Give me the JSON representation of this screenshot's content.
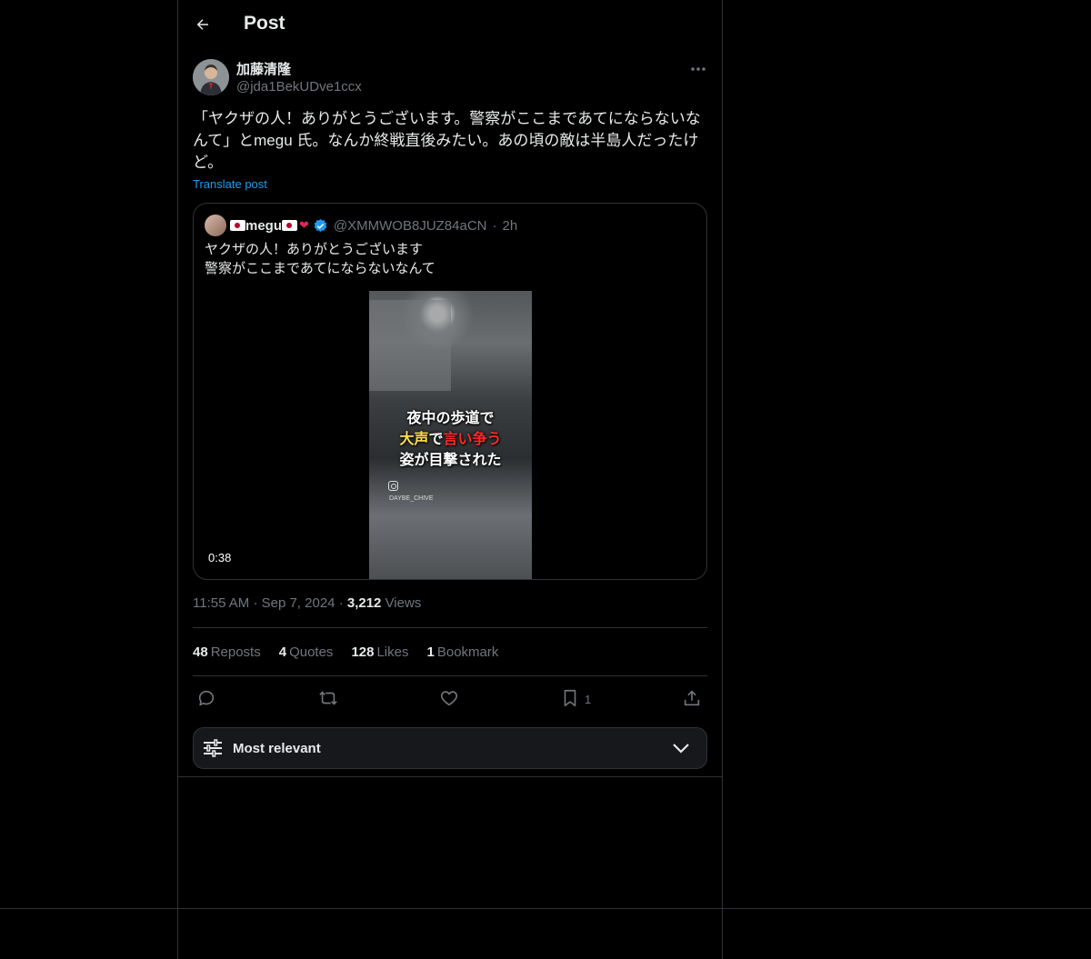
{
  "header": {
    "title": "Post"
  },
  "post": {
    "author_name": "加藤清隆",
    "author_handle": "@jda1BekUDve1ccx",
    "text": "「ヤクザの人！ありがとうございます。警察がここまであてにならないな\nんて」とmegu 氏。なんか終戦直後みたい。あの頃の敵は半島人だったけ\nど。",
    "translate_label": "Translate post"
  },
  "quote": {
    "name": "megu",
    "handle": "@XMMWOB8JUZ84aCN",
    "separator": "·",
    "time": "2h",
    "text": "ヤクザの人！ありがとうございます\n警察がここまであてにならないなんて",
    "video": {
      "caption_line1": "夜中の歩道で",
      "caption_line2_a": "大声",
      "caption_line2_b": "で",
      "caption_line2_c": "言い争う",
      "caption_line3": "姿が目撃された",
      "watermark": "DAYBE_CHIVE",
      "duration": "0:38"
    }
  },
  "meta": {
    "time": "11:55 AM",
    "date": "Sep 7, 2024",
    "separator": "·",
    "views_count": "3,212",
    "views_label": "Views"
  },
  "stats": {
    "reposts_count": "48",
    "reposts_label": "Reposts",
    "quotes_count": "4",
    "quotes_label": "Quotes",
    "likes_count": "128",
    "likes_label": "Likes",
    "bookmarks_count": "1",
    "bookmarks_label": "Bookmark"
  },
  "actions": {
    "reply_icon": "reply-icon",
    "repost_icon": "repost-icon",
    "like_icon": "heart-icon",
    "bookmark_icon": "bookmark-icon",
    "bookmark_count": "1",
    "share_icon": "share-icon"
  },
  "sort": {
    "label": "Most relevant"
  },
  "colors": {
    "background": "#000000",
    "text": "#e7e9ea",
    "secondary_text": "#71767b",
    "link": "#1d9bf0",
    "border": "#2f3336",
    "verified": "#1d9bf0"
  }
}
